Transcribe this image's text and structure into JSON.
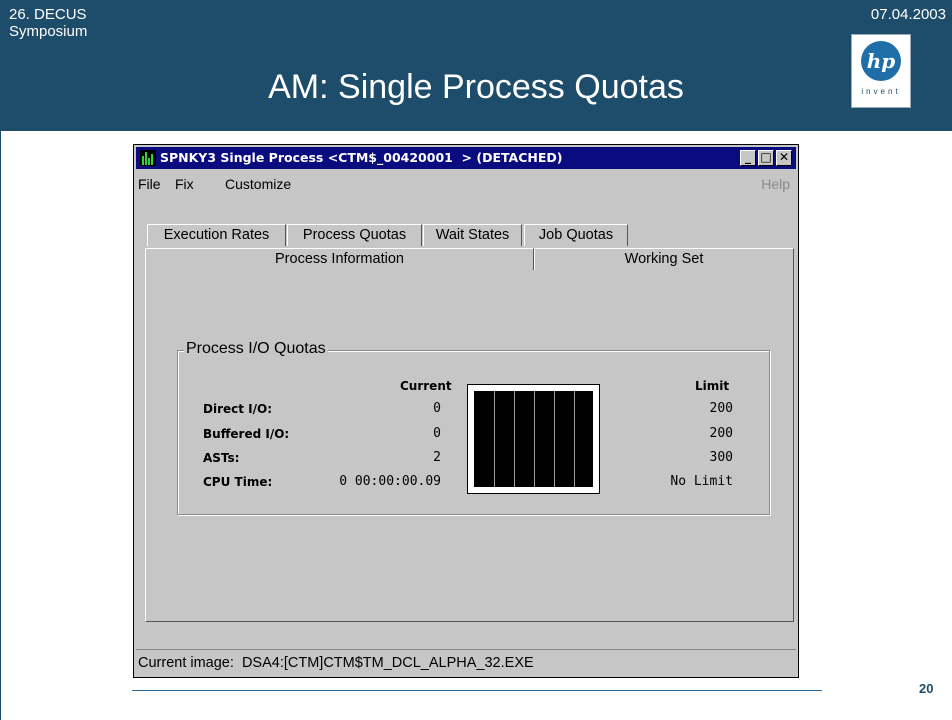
{
  "slide": {
    "org": "26. DECUS\nSymposium",
    "date": "07.04.2003",
    "title": "AM: Single Process Quotas",
    "logo_text": "hp",
    "logo_sub": "invent",
    "page_number": "20"
  },
  "window": {
    "title": "SPNKY3 Single Process <CTM$_00420001  > (DETACHED)",
    "buttons": {
      "minimize": "_",
      "maximize": "□",
      "close": "✕"
    },
    "menu": {
      "file": "File",
      "fix": "Fix",
      "customize": "Customize",
      "help": "Help"
    },
    "tabs_back": [
      "Execution Rates",
      "Process Quotas",
      "Wait States",
      "Job Quotas"
    ],
    "tabs_front": [
      "Process Information",
      "Working Set"
    ],
    "active_tab": "Process Quotas",
    "group": {
      "title": "Process I/O Quotas",
      "col_current": "Current",
      "col_limit": "Limit",
      "rows": [
        {
          "label": "Direct I/O:",
          "current": "0",
          "limit": "200"
        },
        {
          "label": "Buffered I/O:",
          "current": "0",
          "limit": "200"
        },
        {
          "label": "ASTs:",
          "current": "2",
          "limit": "300"
        },
        {
          "label": "CPU Time:",
          "current": "0 00:00:00.09",
          "limit": "No Limit"
        }
      ]
    },
    "status": "Current image:  DSA4:[CTM]CTM$TM_DCL_ALPHA_32.EXE"
  },
  "colors": {
    "header": "#1e4d6b",
    "titlebar": "#0b0b80",
    "window_bg": "#c6c6c6"
  }
}
